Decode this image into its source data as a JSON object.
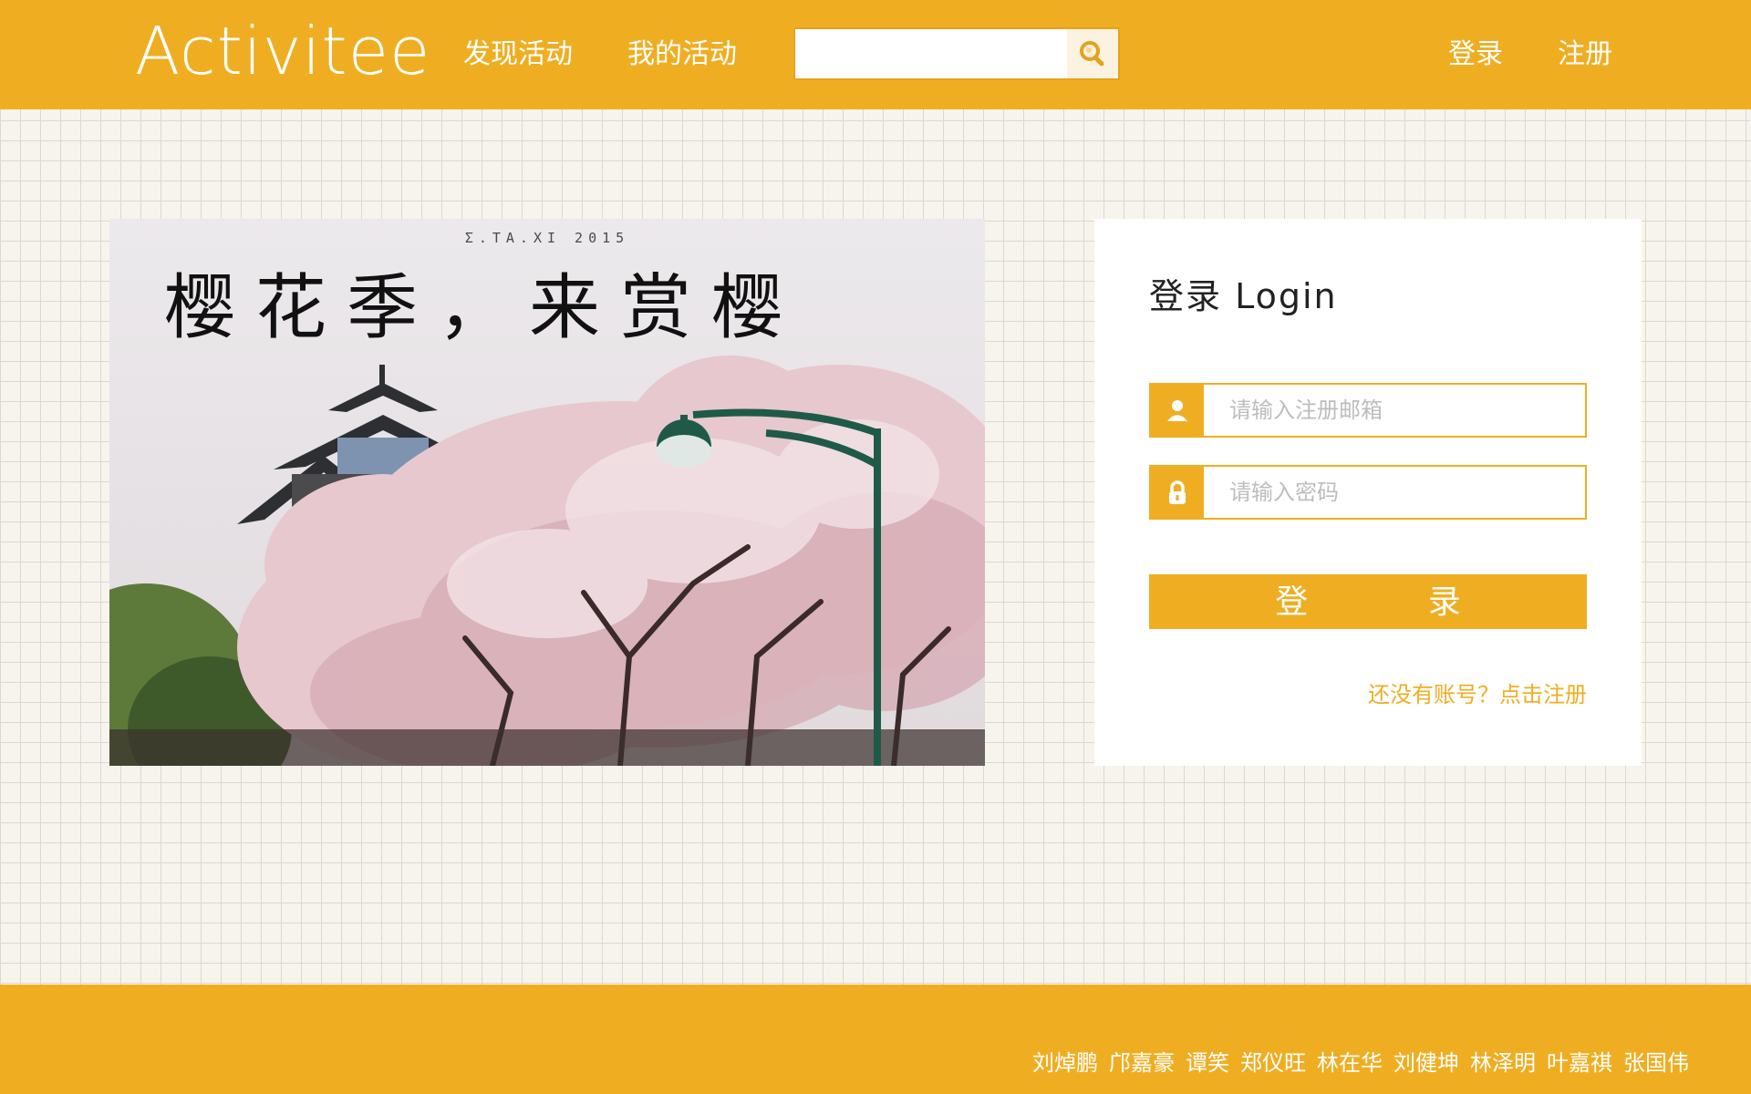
{
  "header": {
    "logo_text": "Activitee",
    "nav": [
      "发现活动",
      "我的活动"
    ],
    "search_placeholder": "",
    "login_label": "登录",
    "register_label": "注册"
  },
  "banner": {
    "credit": "Σ.TA.XI 2015",
    "title": "樱花季，来赏樱"
  },
  "login": {
    "title": "登录 Login",
    "email_placeholder": "请输入注册邮箱",
    "password_placeholder": "请输入密码",
    "submit_label": "登 录",
    "register_prompt": "还没有账号？点击注册"
  },
  "footer": {
    "credits": [
      "刘焯鹏",
      "邝嘉豪",
      "谭笑",
      "郑仪旺",
      "林在华",
      "刘健坤",
      "林泽明",
      "叶嘉祺",
      "张国伟"
    ]
  },
  "theme": {
    "accent": "#efae22",
    "background": "#f7f4ee",
    "grid": "#dcd8d0"
  }
}
